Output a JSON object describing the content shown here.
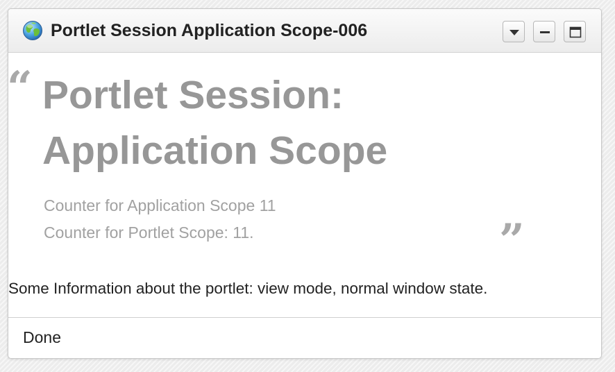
{
  "window": {
    "title": "Portlet Session Application Scope-006",
    "icon": "globe-icon"
  },
  "controls": {
    "menu_icon": "caret-down-icon",
    "minimize_icon": "minimize-icon",
    "maximize_icon": "maximize-icon"
  },
  "quote": {
    "open": "“",
    "close": "”",
    "heading_line1": "Portlet Session:",
    "heading_line2": "Application Scope",
    "counter_application": "Counter for Application Scope 11",
    "counter_portlet": "Counter for Portlet Scope: 11."
  },
  "info": "Some Information about the portlet: view mode, normal window state.",
  "footer": {
    "status": "Done"
  }
}
